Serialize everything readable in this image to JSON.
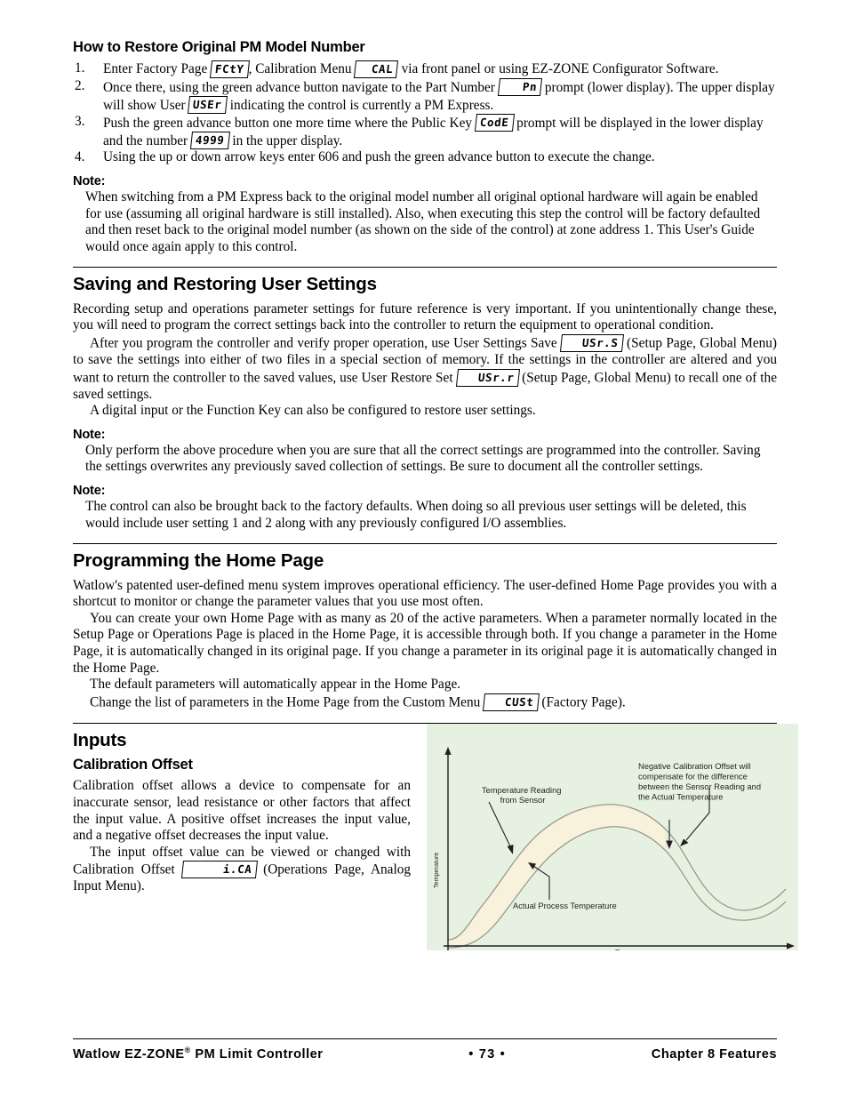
{
  "document": {
    "heading_restore": "How to Restore Original PM Model Number",
    "steps": [
      {
        "num": "1.",
        "parts": [
          {
            "t": "text",
            "v": "Enter Factory Page "
          },
          {
            "t": "seg",
            "v": "FCtY"
          },
          {
            "t": "text",
            "v": ", Calibration Menu "
          },
          {
            "t": "seg",
            "v": "CAL",
            "pad": "sm"
          },
          {
            "t": "text",
            "v": " via front panel or using EZ-ZONE Configurator Software."
          }
        ]
      },
      {
        "num": "2.",
        "parts": [
          {
            "t": "text",
            "v": "Once there, using the green advance button navigate to the Part Number "
          },
          {
            "t": "seg",
            "v": "Pn",
            "pad": "lg"
          },
          {
            "t": "text",
            "v": " prompt (lower display). The upper display will show User "
          },
          {
            "t": "seg",
            "v": "USEr"
          },
          {
            "t": "text",
            "v": " indicating the control is currently a PM Express."
          }
        ]
      },
      {
        "num": "3.",
        "parts": [
          {
            "t": "text",
            "v": "Push the green advance button one more time where the Public Key "
          },
          {
            "t": "seg",
            "v": "CodE"
          },
          {
            "t": "text",
            "v": " prompt will be displayed in the lower display and the number "
          },
          {
            "t": "seg",
            "v": "4999"
          },
          {
            "t": "text",
            "v": " in the upper display."
          }
        ]
      },
      {
        "num": "4.",
        "parts": [
          {
            "t": "text",
            "v": "Using the up or down arrow keys enter 606 and push the green advance button to execute the change."
          }
        ]
      }
    ],
    "note1_label": "Note:",
    "note1_text": "When switching from a PM Express back to the original model number all original optional hardware will again be enabled for use (assuming all original hardware is still installed). Also, when executing this step the control will be factory defaulted and then reset back to the original model number (as shown on the side of the control) at zone address 1. This User's Guide would once again apply to this control.",
    "heading_saving": "Saving and Restoring User Settings",
    "saving_p1": "Recording setup and operations parameter settings for future reference is very important. If you unintentionally change these, you will need to program the correct settings back into the controller to return the equipment to operational condition.",
    "saving_p2": [
      {
        "t": "text",
        "v": "After you program the controller and verify proper operation, use User Settings Save "
      },
      {
        "t": "seg",
        "v": "USr.S"
      },
      {
        "t": "text",
        "v": " (Setup Page, Global Menu) to save the settings into either of two files in a special section of memory. If the settings in the controller are altered and you want to return the controller to the saved values, use User Restore Set "
      },
      {
        "t": "seg",
        "v": "USr.r"
      },
      {
        "t": "text",
        "v": " (Setup Page, Global Menu) to recall one of the saved settings."
      }
    ],
    "saving_p3": "A digital input or the Function Key can also be configured to restore user settings.",
    "note2_label": "Note:",
    "note2_text": "Only perform the above procedure when you are sure that all the correct settings are programmed into the controller. Saving the settings overwrites any previously saved collection of settings. Be sure to document all the controller settings.",
    "note3_label": "Note:",
    "note3_text": "The control can also be brought back to the factory defaults. When doing so all previous user settings will be deleted, this would include user setting 1 and 2 along with any previously configured I/O assemblies.",
    "heading_home": "Programming the Home Page",
    "home_p1": "Watlow's patented user-defined menu system improves operational efficiency. The user-defined Home Page provides you with a shortcut to monitor or change the parameter values that you use most often.",
    "home_p2": "You can create your own Home Page with as many as 20 of the active parameters. When a parameter normally located in the Setup Page or Operations Page is placed in the Home Page, it is accessible through both. If you change a parameter in the Home Page, it is automatically changed in its original page. If you change a parameter in its original page it is automatically changed in the Home Page.",
    "home_p3": "The default parameters will automatically appear in the Home Page.",
    "home_p4": [
      {
        "t": "text",
        "v": "Change the list of parameters in the Home Page from the Custom Menu "
      },
      {
        "t": "seg",
        "v": "CUSt"
      },
      {
        "t": "text",
        "v": " (Factory Page)."
      }
    ],
    "heading_inputs": "Inputs",
    "heading_caloffset": "Calibration Offset",
    "cal_p1": "Calibration offset allows a device to compensate for an inaccurate sensor, lead resistance or other factors that affect the input value. A positive offset increases the input value, and a negative offset decreases the input value.",
    "cal_p2": [
      {
        "t": "text",
        "v": "The input offset value can be viewed or changed with Calibration Offset "
      },
      {
        "t": "seg",
        "v": "i.CA",
        "pad": "lg"
      },
      {
        "t": "text",
        "v": " (Operations Page, Analog Input Menu)."
      }
    ]
  },
  "figure": {
    "bg_color": "#e7f1e2",
    "band_fill": "#f8f1dc",
    "band_stroke": "#9a9a8a",
    "axis_color": "#231f20",
    "y_axis_label": "Temperature",
    "x_axis_label": "Time",
    "annotations": [
      {
        "id": "sensor-reading",
        "lines": [
          "Temperature Reading",
          "from Sensor"
        ]
      },
      {
        "id": "negative-offset",
        "lines": [
          "Negative Calibration Offset will",
          "compensate for the difference",
          "between the Sensor Reading and",
          "the Actual Temperature"
        ]
      },
      {
        "id": "actual-process",
        "lines": [
          "Actual Process Temperature"
        ]
      }
    ]
  },
  "chart_data": {
    "type": "line",
    "title": "",
    "xlabel": "Time",
    "ylabel": "Temperature",
    "grid": false,
    "legend": "none",
    "xlim": [
      0,
      100
    ],
    "ylim": [
      0,
      100
    ],
    "series": [
      {
        "name": "Temperature Reading from Sensor",
        "comment": "upper curve of the band",
        "x": [
          0,
          5,
          12,
          20,
          28,
          36,
          44,
          52,
          60,
          68,
          76,
          84,
          92,
          100
        ],
        "y": [
          28,
          29,
          34,
          45,
          58,
          70,
          78,
          82,
          83,
          80,
          70,
          52,
          36,
          33
        ]
      },
      {
        "name": "Actual Process Temperature",
        "comment": "lower curve of the band, offset below the sensor curve",
        "x": [
          0,
          5,
          12,
          20,
          28,
          36,
          44,
          52,
          60,
          68,
          76,
          84,
          92,
          100
        ],
        "y": [
          18,
          19,
          24,
          35,
          48,
          60,
          68,
          72,
          73,
          70,
          60,
          42,
          26,
          23
        ]
      }
    ],
    "annotations": [
      {
        "text": "Temperature Reading from Sensor",
        "points_to": "upper curve"
      },
      {
        "text": "Actual Process Temperature",
        "points_to": "lower curve"
      },
      {
        "text": "Negative Calibration Offset will compensate for the difference between the Sensor Reading and the Actual Temperature",
        "points_to": "vertical gap between curves"
      }
    ]
  },
  "footer": {
    "left_pre": "Watlow EZ-ZONE",
    "left_sup": "®",
    "left_post": " PM Limit Controller",
    "center": "•  73  •",
    "right": "Chapter 8 Features"
  }
}
